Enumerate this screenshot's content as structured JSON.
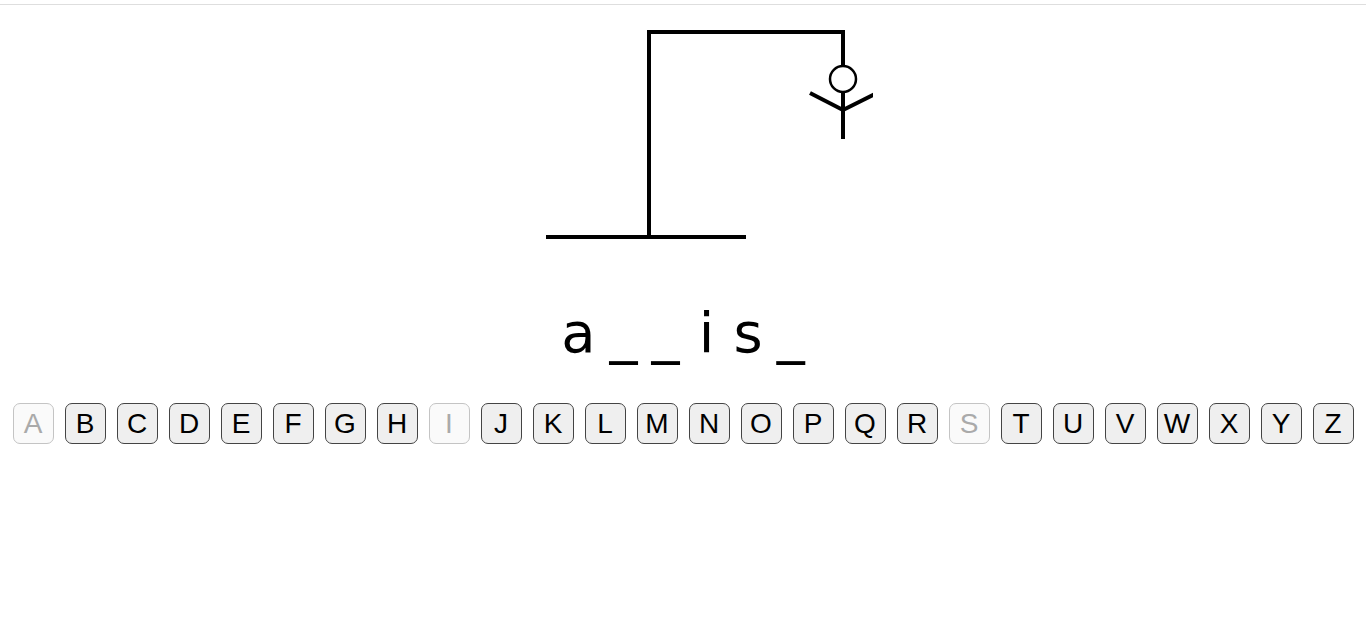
{
  "hangman": {
    "head": true,
    "body": true,
    "left_arm": true,
    "right_arm": true,
    "left_leg": false,
    "right_leg": false
  },
  "word": [
    "a",
    "_",
    "_",
    "i",
    "s",
    "_"
  ],
  "letters": [
    {
      "label": "A",
      "disabled": true
    },
    {
      "label": "B",
      "disabled": false
    },
    {
      "label": "C",
      "disabled": false
    },
    {
      "label": "D",
      "disabled": false
    },
    {
      "label": "E",
      "disabled": false
    },
    {
      "label": "F",
      "disabled": false
    },
    {
      "label": "G",
      "disabled": false
    },
    {
      "label": "H",
      "disabled": false
    },
    {
      "label": "I",
      "disabled": true
    },
    {
      "label": "J",
      "disabled": false
    },
    {
      "label": "K",
      "disabled": false
    },
    {
      "label": "L",
      "disabled": false
    },
    {
      "label": "M",
      "disabled": false
    },
    {
      "label": "N",
      "disabled": false
    },
    {
      "label": "O",
      "disabled": false
    },
    {
      "label": "P",
      "disabled": false
    },
    {
      "label": "Q",
      "disabled": false
    },
    {
      "label": "R",
      "disabled": false
    },
    {
      "label": "S",
      "disabled": true
    },
    {
      "label": "T",
      "disabled": false
    },
    {
      "label": "U",
      "disabled": false
    },
    {
      "label": "V",
      "disabled": false
    },
    {
      "label": "W",
      "disabled": false
    },
    {
      "label": "X",
      "disabled": false
    },
    {
      "label": "Y",
      "disabled": false
    },
    {
      "label": "Z",
      "disabled": false
    }
  ]
}
